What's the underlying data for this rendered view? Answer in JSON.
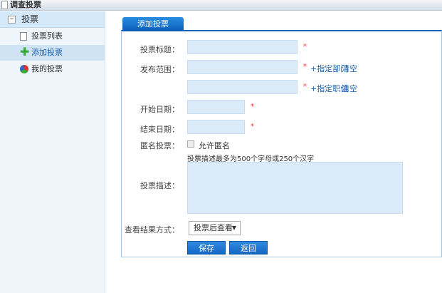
{
  "window": {
    "title": "调查投票"
  },
  "sidebar": {
    "group": "投票",
    "items": [
      {
        "label": "投票列表",
        "icon": "document-icon"
      },
      {
        "label": "添加投票",
        "icon": "plus-icon",
        "selected": true
      },
      {
        "label": "我的投票",
        "icon": "pie-icon"
      }
    ]
  },
  "tab": {
    "label": "添加投票"
  },
  "form": {
    "title_label": "投票标题：",
    "title_value": "",
    "range_label": "发布范围：",
    "dept_link": "+指定部门",
    "dept_clear": "清空",
    "pos_link": "+指定职位",
    "pos_clear": "清空",
    "required": "*",
    "start_label": "开始日期：",
    "end_label": "结束日期：",
    "anon_label": "匿名投票：",
    "anon_option": "允许匿名",
    "anon_checked": false,
    "desc_hint": "投票描述最多为500个字母或250个汉字",
    "desc_label": "投票描述：",
    "view_label": "查看结果方式：",
    "view_value": "投票后查看",
    "save": "保存",
    "back": "返回"
  },
  "colors": {
    "accent": "#0b5fb8",
    "input_bg": "#dcebf9",
    "required": "#e33333"
  }
}
